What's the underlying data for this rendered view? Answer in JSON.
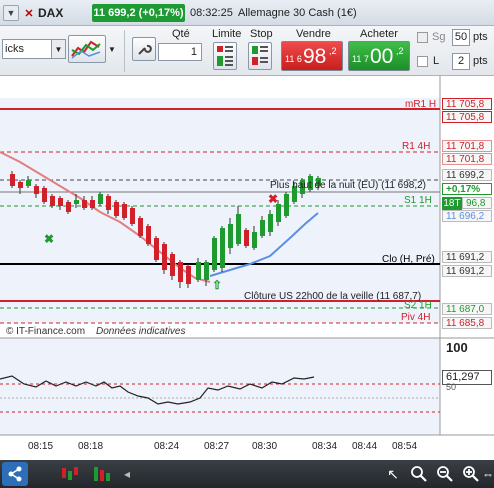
{
  "title_bar": {
    "instrument_code": "DAX",
    "last_quote": "11 699,2 (+0,17%)",
    "time": "08:32:25",
    "instrument_name": "Allemagne 30 Cash (1€)"
  },
  "toolbar": {
    "interval_value": "icks",
    "qty_label": "Qté",
    "qty_value": "1",
    "limit_label": "Limite",
    "stop_label": "Stop",
    "sell_label": "Vendre",
    "sell_price_small": "11 6",
    "sell_price_big": "98",
    "sell_price_sup": ",2",
    "buy_label": "Acheter",
    "buy_price_small": "11 7",
    "buy_price_big": "00",
    "buy_price_sup": ",2",
    "sg_label": "Sg",
    "sg_value": "50",
    "sg_unit": "pts",
    "l_label": "L",
    "l_value": "2",
    "l_unit": "pts"
  },
  "chart": {
    "level_labels": {
      "mr1": "mR1 H",
      "r1_4h": "R1 4H",
      "night_high": "Plus haut de la nuit (EU) (11 698,2)",
      "s1_1h": "S1 1H",
      "clo": "Clo (H, Pré)",
      "us_close": "Clôture US 22h00 de la veille (11 687,7)",
      "s2_1h": "S2 1H",
      "piv_4h": "Piv 4H"
    },
    "price_axis": {
      "p1": "11 705,8",
      "p2": "11 705,8",
      "p3": "11 701,8",
      "p4": "11 701,8",
      "p5": "11 699,2",
      "pct": "+0,17%",
      "t18": "18T",
      "p6": "96,8",
      "p7": "11 696,2",
      "p8": "11 691,2",
      "p9": "11 691,2",
      "p10": "11 687,0",
      "p11": "11 685,8"
    },
    "watermark": "© IT-Finance.com",
    "disclaimer": "Données indicatives",
    "osc_axis_top": "100",
    "osc_value": "61,297",
    "osc_axis_mid": "50",
    "time_labels": [
      "08:15",
      "08:18",
      "08:24",
      "08:27",
      "08:30",
      "08:34",
      "08:44",
      "08:54"
    ],
    "colors": {
      "bull": "#1e9a2e",
      "bear": "#d0202a",
      "ma_red": "#e08080",
      "ma_blue": "#5b8fe0",
      "resistance": "#d0202a",
      "support": "#1e9a2e"
    }
  },
  "bottom_bar": {
    "icons": [
      "share-icon",
      "candles-icon",
      "bars-icon",
      "cursor-icon",
      "zoom-fit-icon",
      "zoom-in-icon",
      "zoom-out-icon",
      "settings-icon",
      "scroll-icon"
    ]
  }
}
